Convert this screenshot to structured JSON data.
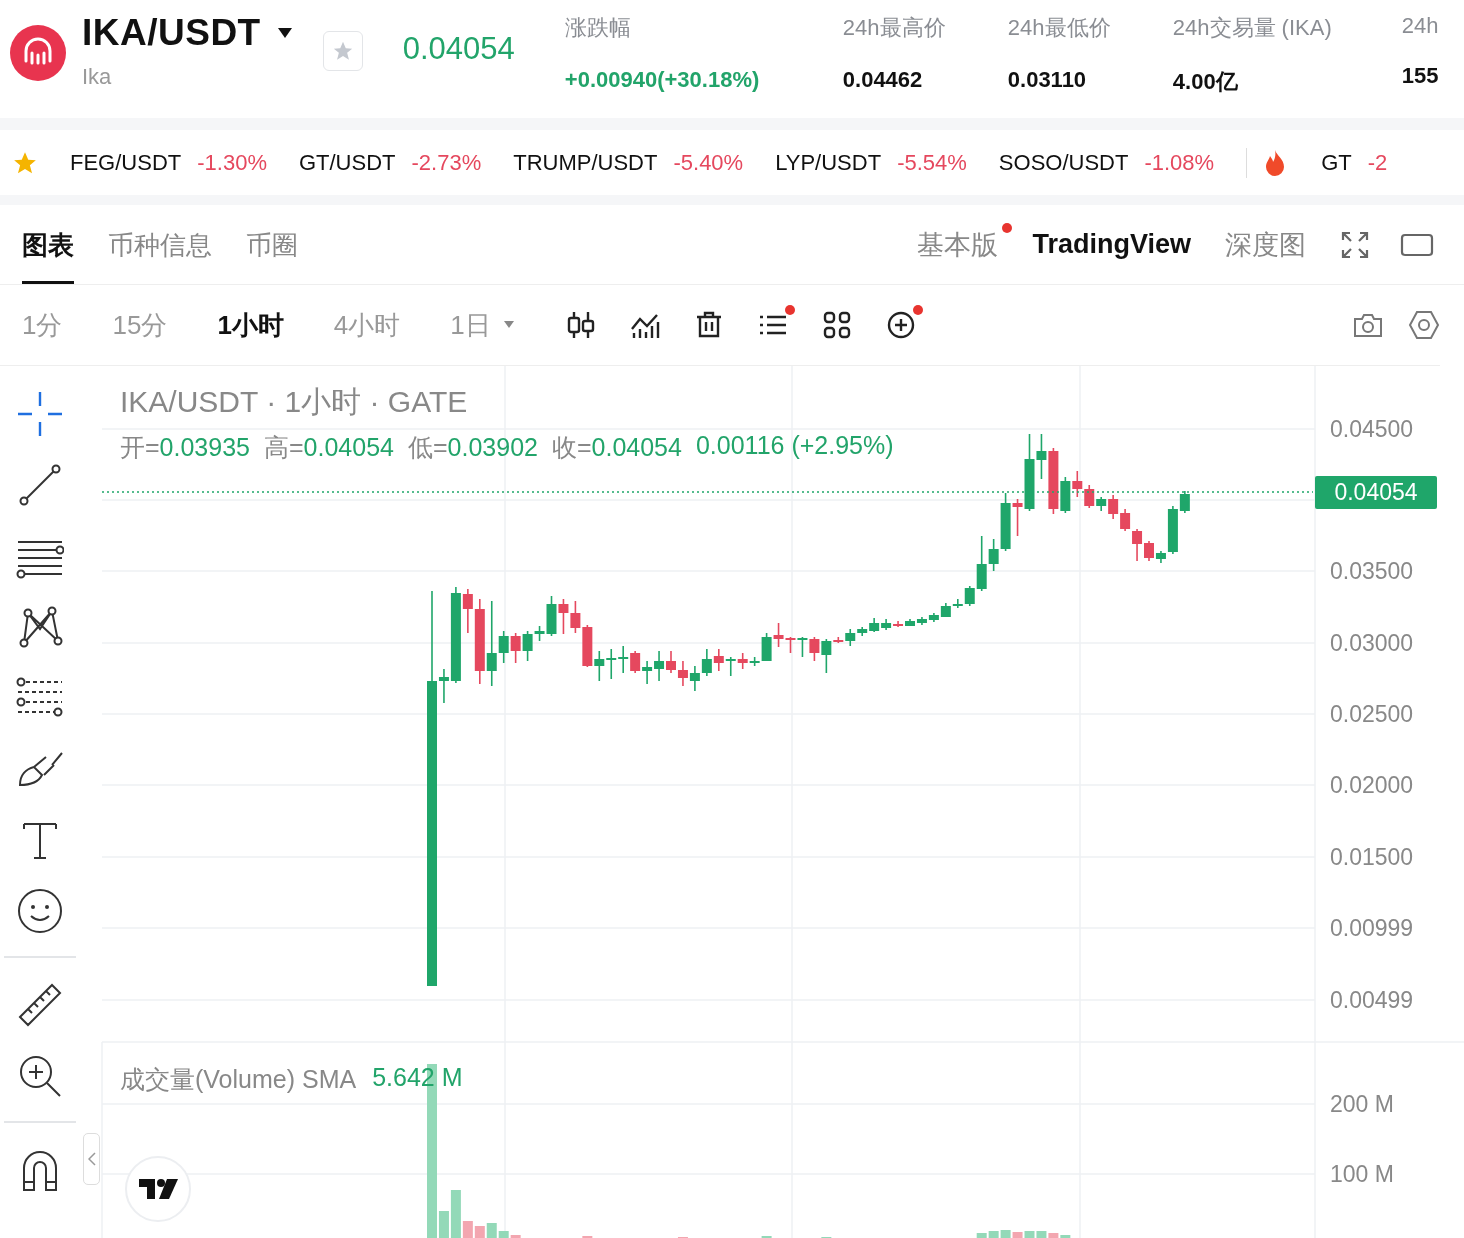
{
  "header": {
    "pair": "IKA/USDT",
    "name": "Ika",
    "price": "0.04054",
    "favorite": false,
    "stats": [
      {
        "label": "涨跌幅",
        "value": "+0.00940(+30.18%)",
        "kind": "change"
      },
      {
        "label": "24h最高价",
        "value": "0.04462",
        "kind": "plain"
      },
      {
        "label": "24h最低价",
        "value": "0.03110",
        "kind": "plain"
      },
      {
        "label": "24h交易量 (IKA)",
        "value": "4.00亿",
        "kind": "plain"
      },
      {
        "label": "24h",
        "value": "155",
        "kind": "plain"
      }
    ]
  },
  "ticker": {
    "items": [
      {
        "pair": "FEG/USDT",
        "change": "-1.30%"
      },
      {
        "pair": "GT/USDT",
        "change": "-2.73%"
      },
      {
        "pair": "TRUMP/USDT",
        "change": "-5.40%"
      },
      {
        "pair": "LYP/USDT",
        "change": "-5.54%"
      },
      {
        "pair": "SOSO/USDT",
        "change": "-1.08%"
      }
    ],
    "hot": [
      {
        "pair": "GT",
        "change": "-2"
      }
    ]
  },
  "tabs": [
    {
      "label": "图表",
      "selected": true
    },
    {
      "label": "币种信息",
      "selected": false
    },
    {
      "label": "币圈",
      "selected": false
    }
  ],
  "views": [
    {
      "label": "基本版",
      "selected": false,
      "dot": true
    },
    {
      "label": "TradingView",
      "selected": true,
      "dot": false
    },
    {
      "label": "深度图",
      "selected": false,
      "dot": false
    }
  ],
  "intervals": [
    {
      "label": "1分",
      "selected": false,
      "dropdown": false
    },
    {
      "label": "15分",
      "selected": false,
      "dropdown": false
    },
    {
      "label": "1小时",
      "selected": true,
      "dropdown": false
    },
    {
      "label": "4小时",
      "selected": false,
      "dropdown": false
    },
    {
      "label": "1日",
      "selected": false,
      "dropdown": true
    }
  ],
  "tools": [
    {
      "kind": "candles",
      "dot": false
    },
    {
      "kind": "indicators",
      "dot": false
    },
    {
      "kind": "delete",
      "dot": false
    },
    {
      "kind": "list",
      "dot": true
    },
    {
      "kind": "grid",
      "dot": false
    },
    {
      "kind": "add",
      "dot": true
    }
  ],
  "chart": {
    "title": "IKA/USDT · 1小时 · GATE",
    "ohlc": [
      {
        "label": "开=",
        "value": "0.03935"
      },
      {
        "label": "高=",
        "value": "0.04054"
      },
      {
        "label": "低=",
        "value": "0.03902"
      },
      {
        "label": "收=",
        "value": "0.04054"
      }
    ],
    "change": "0.00116 (+2.95%)",
    "y_labels": [
      "0.04500",
      "0.03500",
      "0.03000",
      "0.02500",
      "0.02000",
      "0.01500",
      "0.00999",
      "0.00499"
    ],
    "last_price": "0.04054",
    "volume": {
      "label": "成交量(Volume) SMA",
      "value": "5.642 M",
      "y_labels": [
        "200 M",
        "100 M"
      ]
    }
  }
}
